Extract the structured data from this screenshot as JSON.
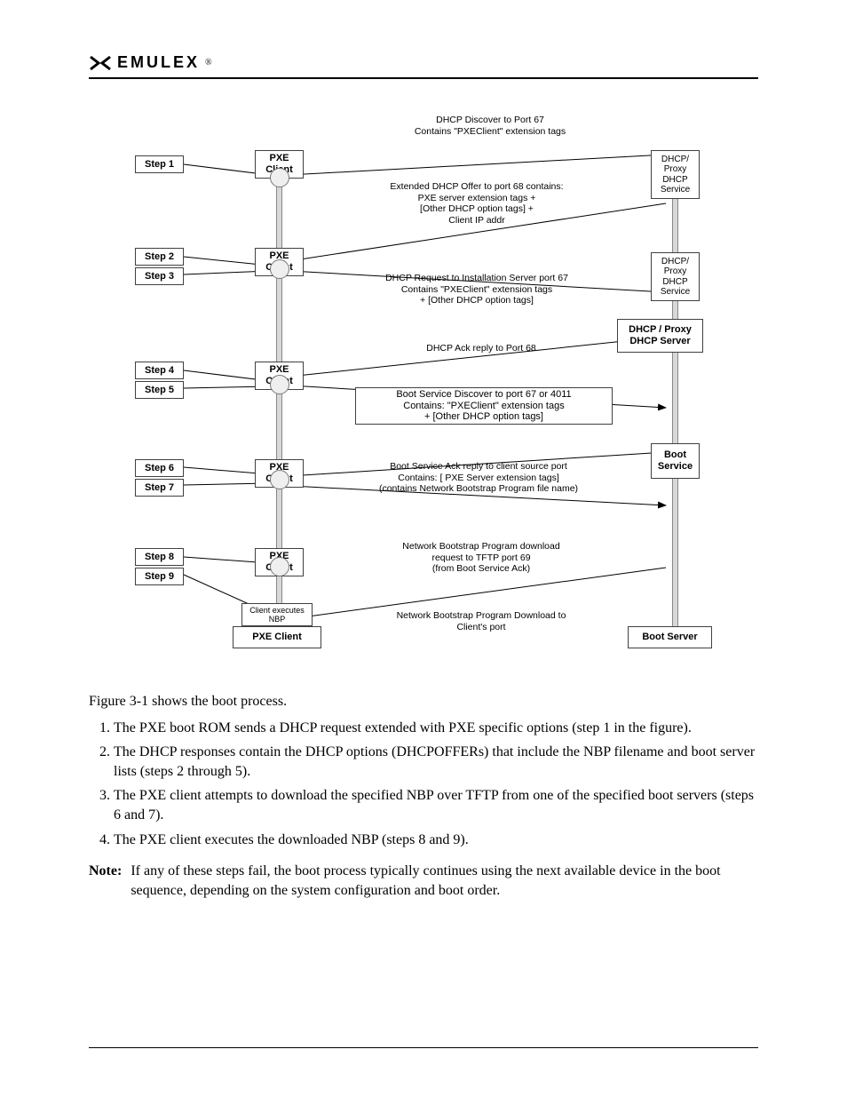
{
  "logo_text": "EMULEX",
  "dia": {
    "steps": [
      "Step 1",
      "Step 2",
      "Step 3",
      "Step 4",
      "Step 5",
      "Step 6",
      "Step 7",
      "Step 8",
      "Step 9"
    ],
    "pxe_client": "PXE\nClient",
    "dhcp_service": "DHCP/\nProxy\nDHCP\nService",
    "boot_service": "Boot\nService",
    "dhcp_proxy_server": "DHCP / Proxy\nDHCP Server",
    "client_executes": "Client executes\nNBP",
    "pxe_client_label": "PXE Client",
    "boot_server_label": "Boot Server",
    "msg1": "DHCP Discover to Port 67\nContains  \"PXEClient\" extension tags",
    "msg2": "Extended DHCP Offer to port 68 contains:\nPXE server extension tags +\n[Other DHCP option tags] +\nClient IP addr",
    "msg3": "DHCP Request to Installation Server port 67\nContains  \"PXEClient\" extension tags\n+ [Other DHCP option tags]",
    "msg4": "DHCP Ack reply to Port 68",
    "msg5": "Boot Service Discover to port 67 or 4011\nContains: \"PXEClient\" extension tags\n+ [Other DHCP option tags]",
    "msg6": "Boot Service Ack reply to client source port\nContains: [ PXE Server extension tags]\n(contains Network Bootstrap Program file name)",
    "msg7": "Network Bootstrap Program download\nrequest to TFTP port 69\n(from Boot Service Ack)",
    "msg8": "Network Bootstrap Program Download to\nClient's port"
  },
  "body": {
    "intro": "Figure 3-1 shows the boot process.",
    "items": [
      "The PXE boot ROM sends a DHCP request extended with PXE specific options (step 1 in the figure).",
      "The DHCP responses contain the DHCP options (DHCPOFFERs) that include the NBP filename and boot server lists (steps 2 through 5).",
      "The PXE client attempts to download the specified NBP over TFTP from one of the specified boot servers (steps 6 and 7).",
      "The PXE client executes the downloaded NBP (steps 8 and 9)."
    ],
    "note_label": "Note:",
    "note_text": "If any of these steps fail, the boot process typically continues using the next available device in the boot sequence, depending on the system configuration and boot order."
  }
}
